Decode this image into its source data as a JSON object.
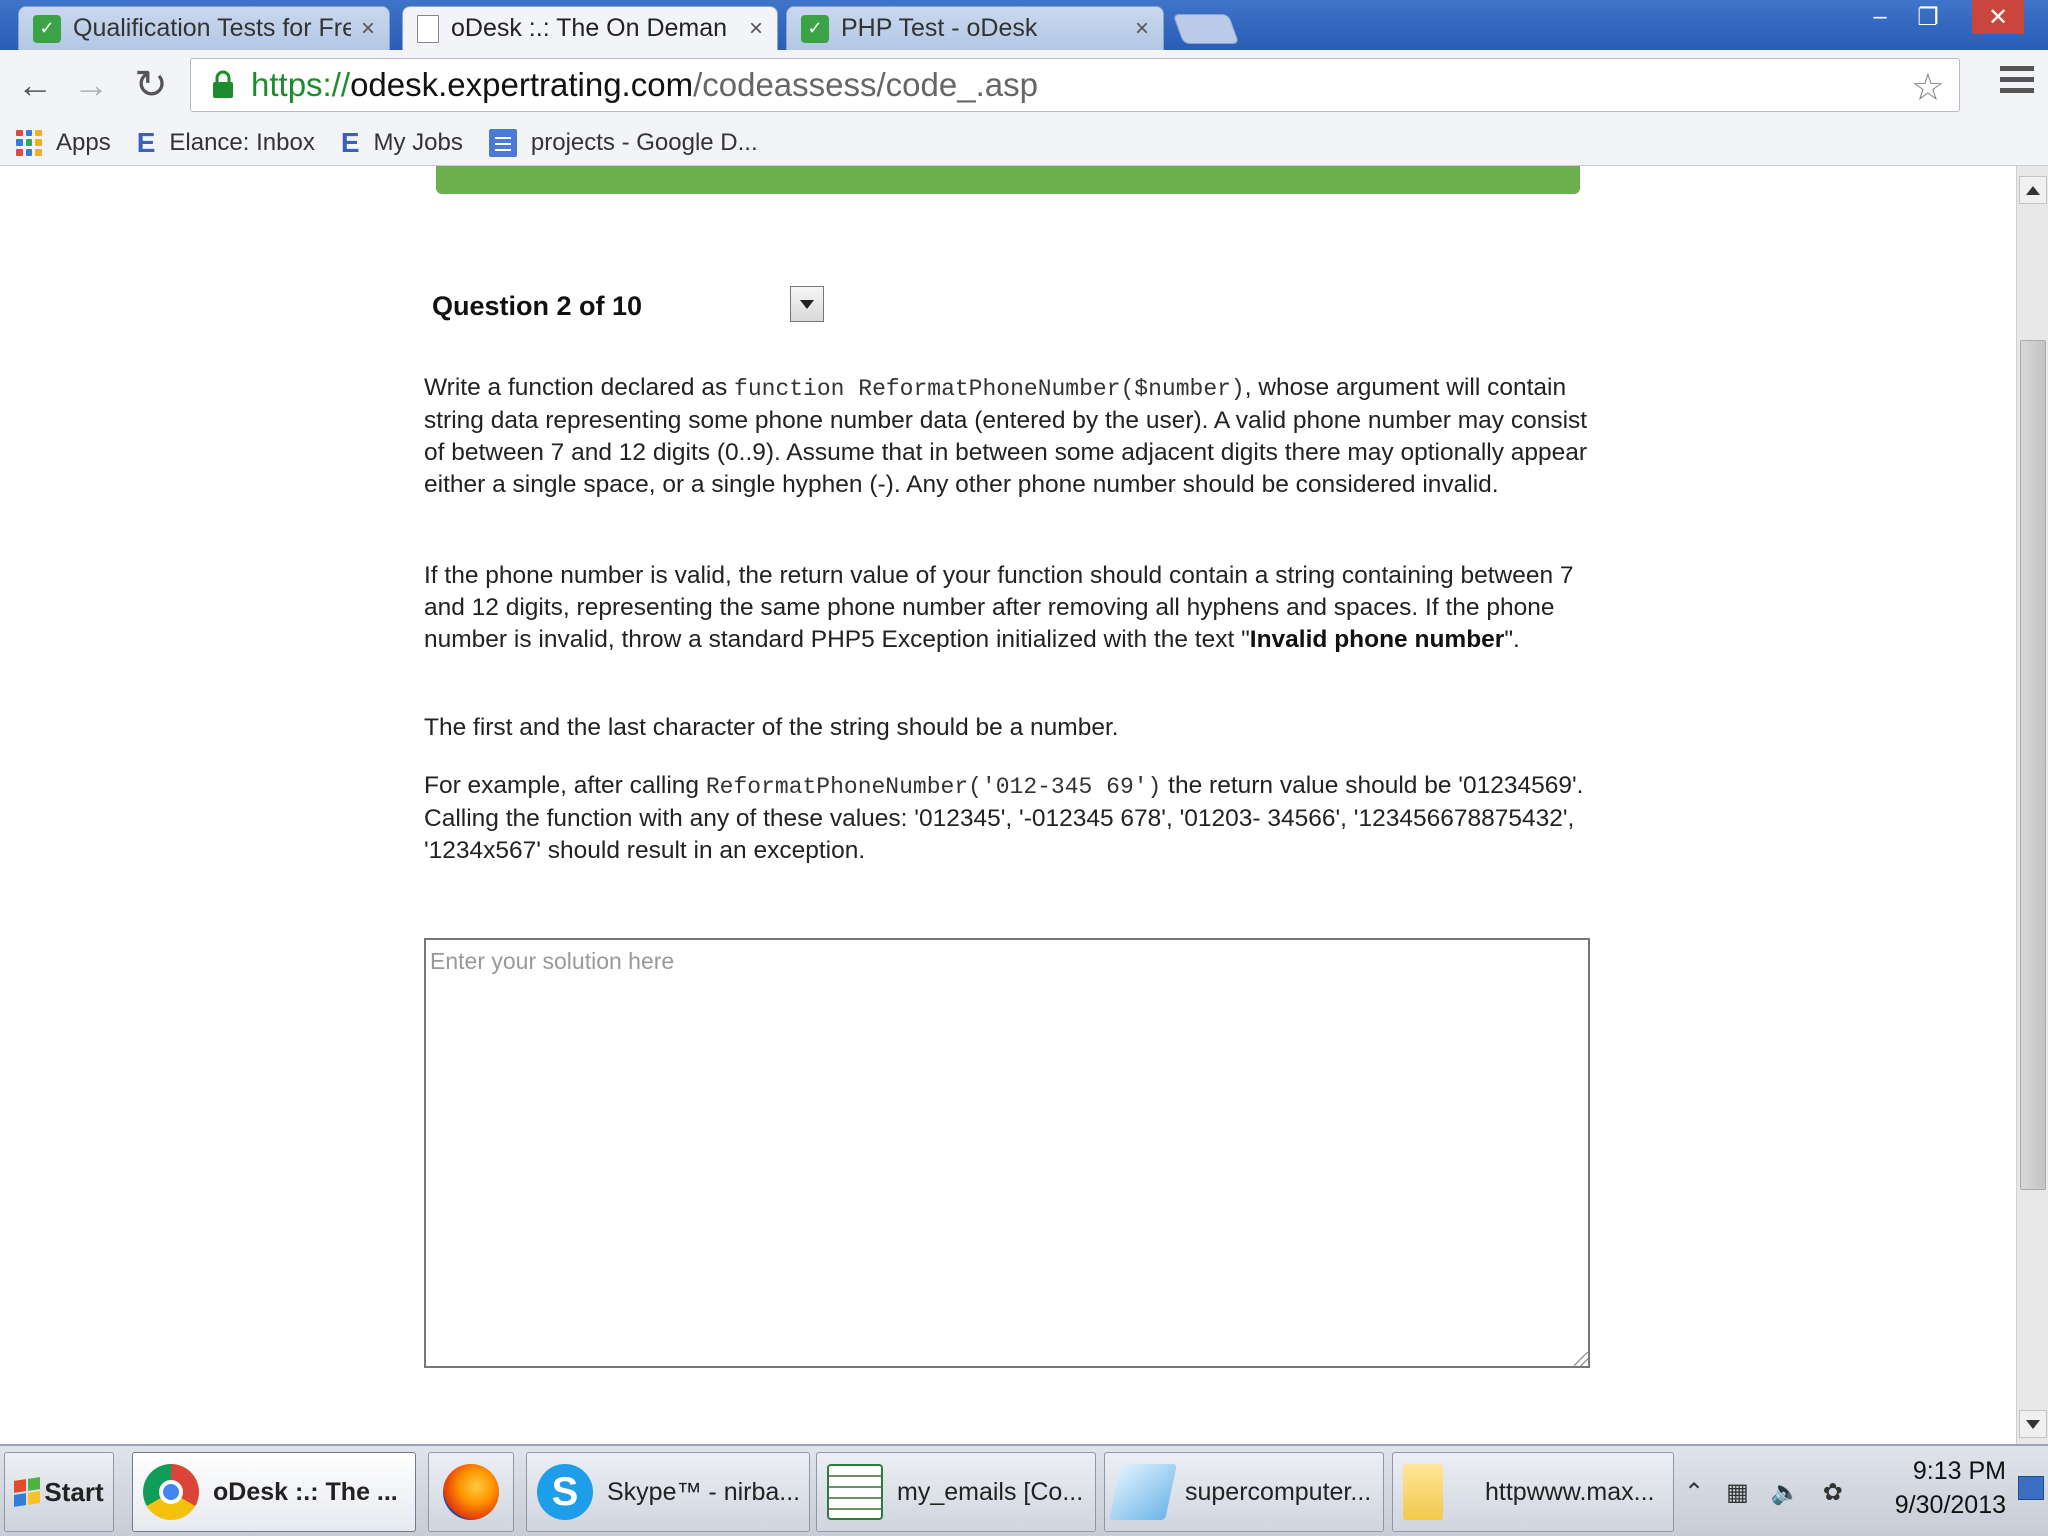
{
  "browser": {
    "tabs": [
      {
        "title": "Qualification Tests for Fre",
        "close": "×",
        "favicon_color": "#3ca246",
        "favicon_glyph": "✓"
      },
      {
        "title": "oDesk :.: The On Deman",
        "close": "×",
        "favicon_color": "#ffffff",
        "favicon_glyph": ""
      },
      {
        "title": "PHP Test - oDesk",
        "close": "×",
        "favicon_color": "#3ca246",
        "favicon_glyph": "✓"
      }
    ],
    "window_controls": {
      "minimize": "–",
      "restore": "❐",
      "close": "✕"
    },
    "url_scheme": "https://",
    "url_host": "odesk.expertrating.com",
    "url_path": "/codeassess/code_.asp",
    "bookmarks": [
      {
        "label": "Apps",
        "icon": "apps-grid-icon"
      },
      {
        "label": "Elance: Inbox",
        "icon": "elance-icon",
        "glyph": "E"
      },
      {
        "label": "My Jobs",
        "icon": "elance-icon",
        "glyph": "E"
      },
      {
        "label": "projects - Google D...",
        "icon": "google-docs-icon"
      }
    ]
  },
  "page": {
    "accent_color": "#6cb14e",
    "question_label": "Question 2 of 10",
    "p1_a": "Write a function declared as ",
    "p1_code": "function ReformatPhoneNumber($number)",
    "p1_b": ", whose argument will contain string data representing some phone number data (entered by the user). A valid phone number may consist of between 7 and 12 digits (0..9). Assume that in between some adjacent digits there may optionally appear either a single space, or a single hyphen (-). Any other phone number should be considered invalid.",
    "p2_a": "If the phone number is valid, the return value of your function should contain a string containing between 7 and 12 digits, representing the same phone number after removing all hyphens and spaces. If the phone number is invalid, throw a standard PHP5 Exception initialized with the text \"",
    "p2_bold": "Invalid phone number",
    "p2_b": "\".",
    "p3": "The first and the last character of the string should be a number.",
    "p4_a": "For example, after calling ",
    "p4_code": "ReformatPhoneNumber('012-345 69')",
    "p4_b": " the return value should be '01234569'. Calling the function with any of these values: '012345', '-012345 678', '01203- 34566', '123456678875432', '1234x567' should result in an exception.",
    "solution_placeholder": "Enter your solution here"
  },
  "taskbar": {
    "start_label": "Start",
    "tasks": [
      {
        "label": "oDesk :.: The ...",
        "icon": "chrome-icon"
      },
      {
        "label": "",
        "icon": "firefox-icon"
      },
      {
        "label": "Skype™ - nirba...",
        "icon": "skype-icon"
      },
      {
        "label": "my_emails  [Co...",
        "icon": "excel-icon"
      },
      {
        "label": "supercomputer...",
        "icon": "notepad-icon"
      },
      {
        "label": "httpwww.max...",
        "icon": "folder-icon"
      }
    ],
    "clock_time": "9:13 PM",
    "clock_date": "9/30/2013"
  }
}
